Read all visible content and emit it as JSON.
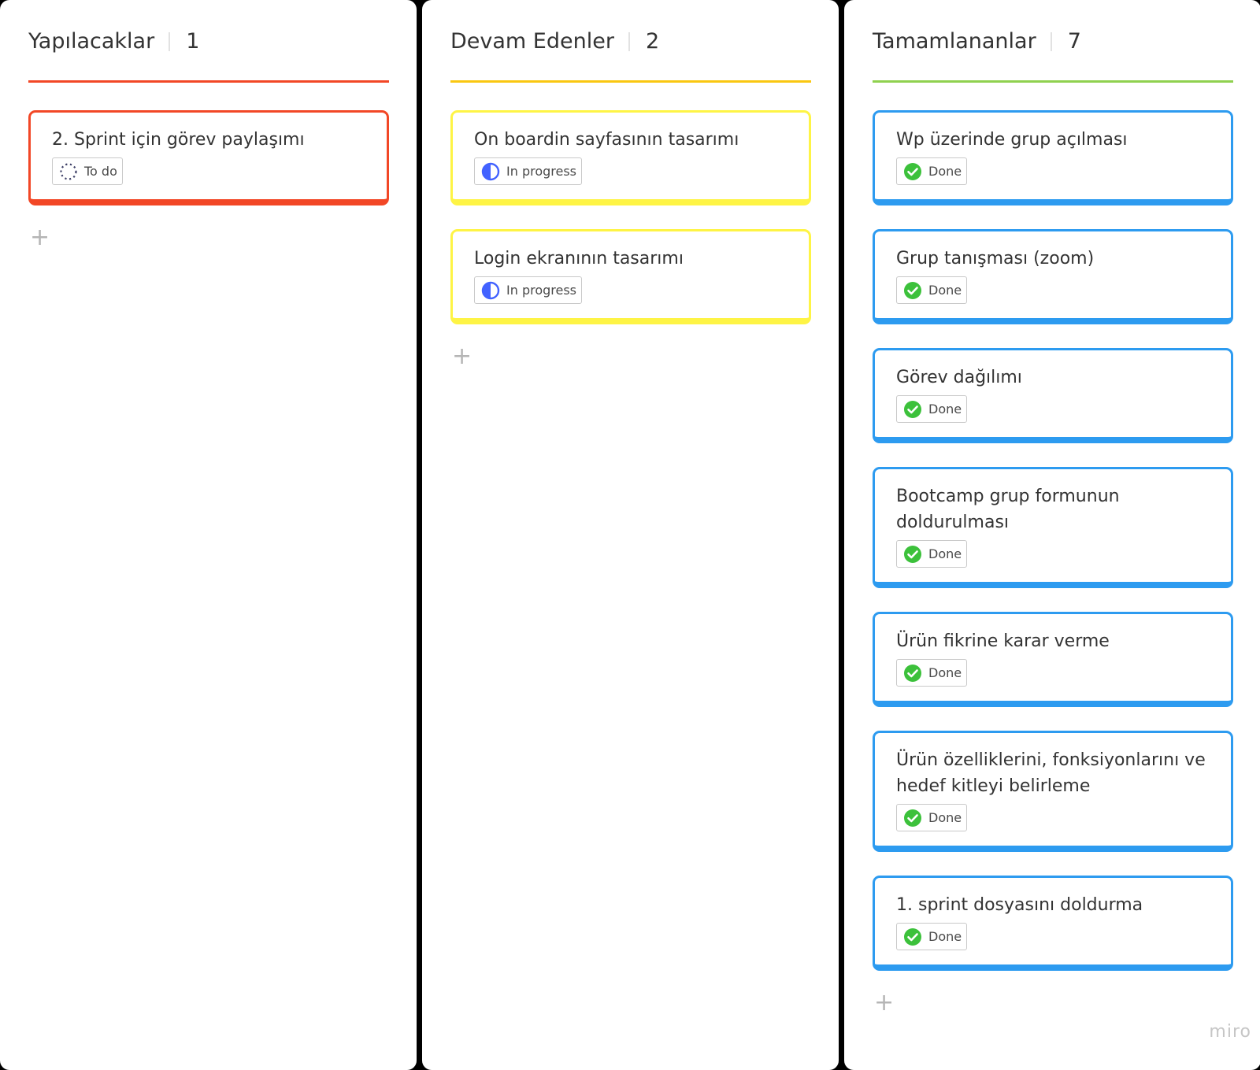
{
  "colors": {
    "todo": "#f24726",
    "in_progress": "#fef445",
    "in_progress_rule": "#fac710",
    "done_card": "#2d9bf0",
    "done_rule": "#8fd14f",
    "progress_icon": "#4262ff",
    "check_icon": "#3cc13b"
  },
  "columns": [
    {
      "title": "Yapılacaklar",
      "count": "1",
      "cards": [
        {
          "title": "2. Sprint için görev paylaşımı",
          "status": "To do",
          "icon": "dashed-circle-icon"
        }
      ],
      "add_label": "+"
    },
    {
      "title": "Devam Edenler",
      "count": "2",
      "cards": [
        {
          "title": "On boardin sayfasının tasarımı",
          "status": "In progress",
          "icon": "half-circle-icon"
        },
        {
          "title": "Login ekranının tasarımı",
          "status": "In progress",
          "icon": "half-circle-icon"
        }
      ],
      "add_label": "+"
    },
    {
      "title": "Tamamlananlar",
      "count": "7",
      "cards": [
        {
          "title": "Wp üzerinde grup açılması",
          "status": "Done",
          "icon": "check-circle-icon"
        },
        {
          "title": "Grup tanışması (zoom)",
          "status": "Done",
          "icon": "check-circle-icon"
        },
        {
          "title": "Görev dağılımı",
          "status": "Done",
          "icon": "check-circle-icon"
        },
        {
          "title": "Bootcamp grup formunun doldurulması",
          "status": "Done",
          "icon": "check-circle-icon"
        },
        {
          "title": "Ürün fikrine karar verme",
          "status": "Done",
          "icon": "check-circle-icon"
        },
        {
          "title": "Ürün özelliklerini, fonksiyonlarını ve hedef kitleyi belirleme",
          "status": "Done",
          "icon": "check-circle-icon"
        },
        {
          "title": "1. sprint dosyasını doldurma",
          "status": "Done",
          "icon": "check-circle-icon"
        }
      ],
      "add_label": "+"
    }
  ],
  "brand": "miro"
}
